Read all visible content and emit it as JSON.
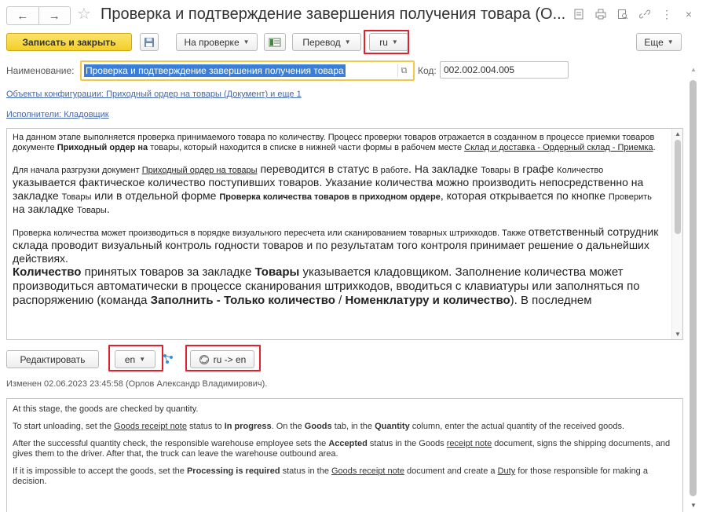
{
  "window": {
    "title": "Проверка и подтверждение завершения получения товара (О...",
    "back_label": "←",
    "forward_label": "→",
    "star": "☆",
    "more_label": "⋮",
    "close_label": "×"
  },
  "toolbar": {
    "save_close": "Записать и закрыть",
    "status_select": "На проверке",
    "translate_menu": "Перевод",
    "lang_select": "ru",
    "more_menu": "Еще"
  },
  "fields": {
    "name_label": "Наименование:",
    "name_value": "Проверка и подтверждение завершения получения товара",
    "code_label": "Код:",
    "code_value": "002.002.004.005"
  },
  "links": {
    "objects": "Объекты конфигурации: Приходный ордер на товары (Документ) и еще 1",
    "performers": "Исполнители: Кладовщик"
  },
  "description_ru": {
    "p1_a": "На данном этапе выполняется проверка принимаемого товара по количеству. Процесс проверки товаров отражается в созданном в процессе приемки товаров документе ",
    "p1_b": "Приходный ордер на",
    "p1_c": " товары, который находится в списке в нижней части формы в рабочем месте ",
    "p1_link": "Склад и доставка - Ордерный склад - Приемка",
    "p1_d": ".",
    "p2_a": "Для начала разгрузки документ ",
    "p2_link": "Приходный ордер на товары",
    "p2_b": " переводится в статус ",
    "p2_status": "В работе",
    "p2_c": ". На закладке ",
    "p2_tab1": "Товары",
    "p2_d": " в графе ",
    "p2_col": "Количество",
    "p2_e": " указывается фактическое количество поступивших товаров. Указание количества можно производить непосредственно на закладке ",
    "p2_tab2": "Товары",
    "p2_f": " или в отдельной форме ",
    "p2_form": "Проверка количества товаров в приходном ордере",
    "p2_g": ", которая открывается по кнопке ",
    "p2_btn": "Проверить",
    "p2_h": " на закладке ",
    "p2_tab3": "Товары",
    "p2_i": ".",
    "p3_a": "Проверка количества может производиться в порядке визуального пересчета или сканированием товарных штрихкодов. Также ",
    "p3_b": "ответственный сотрудник склада проводит визуальный контроль годности товаров и по результатам того контроля принимает решение о дальнейших действиях.",
    "p4_a": "Количество",
    "p4_b": " принятых товаров за закладке ",
    "p4_c": "Товары",
    "p4_d": " указывается кладовщиком. Заполнение количества может производиться автоматически в процессе сканирования штрихкодов, вводиться с клавиатуры или заполняться по распоряжению (команда ",
    "p4_e": "Заполнить - Только количество",
    "p4_f": " / ",
    "p4_g": "Номенклатуру и количество",
    "p4_h": "). В последнем"
  },
  "bottom_toolbar": {
    "edit_button": "Редактировать",
    "target_lang": "en",
    "translate_direction": "ru -> en"
  },
  "changed_info": "Изменен 02.06.2023 23:45:58 (Орлов Александр Владимирович).",
  "description_en": {
    "p1": "At this stage, the goods are checked by quantity.",
    "p2_a": "To start unloading, set the ",
    "p2_link": "Goods receipt note",
    "p2_b": " status to ",
    "p2_status": "In progress",
    "p2_c": ". On the ",
    "p2_tab": "Goods",
    "p2_d": " tab, in the ",
    "p2_col": "Quantity",
    "p2_e": " column, enter the actual quantity of the received goods.",
    "p3_a": "After the successful quantity check, the responsible warehouse employee sets the ",
    "p3_status": "Accepted",
    "p3_b": " status in the Goods ",
    "p3_link": "receipt note",
    "p3_c": " document, signs the shipping documents, and gives them to the driver. After that, the truck can leave the warehouse outbound area.",
    "p4_a": "If it is impossible to accept the goods, set the ",
    "p4_status": "Processing is required",
    "p4_b": " status in the ",
    "p4_link": "Goods receipt note",
    "p4_c": " document and create a ",
    "p4_link2": "Duty",
    "p4_d": " for those responsible for making a decision."
  },
  "colors": {
    "primary_button": "#f3cf2a",
    "highlight_border": "#e0212d",
    "focus_border": "#f0c94b",
    "selection": "#3a7fd5",
    "link": "#4466aa"
  },
  "icons": [
    "back-icon",
    "forward-icon",
    "star-icon",
    "doc-icon",
    "print-icon",
    "preview-icon",
    "link-icon",
    "more-icon",
    "close-icon",
    "save-icon",
    "structure-icon",
    "copy-icon",
    "tree-icon",
    "translate-icon"
  ]
}
